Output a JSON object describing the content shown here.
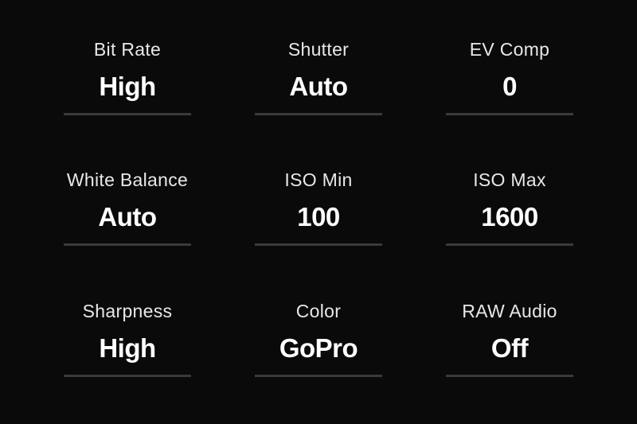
{
  "settings": [
    {
      "label": "Bit Rate",
      "value": "High"
    },
    {
      "label": "Shutter",
      "value": "Auto"
    },
    {
      "label": "EV Comp",
      "value": "0"
    },
    {
      "label": "White Balance",
      "value": "Auto"
    },
    {
      "label": "ISO Min",
      "value": "100"
    },
    {
      "label": "ISO Max",
      "value": "1600"
    },
    {
      "label": "Sharpness",
      "value": "High"
    },
    {
      "label": "Color",
      "value": "GoPro"
    },
    {
      "label": "RAW Audio",
      "value": "Off"
    }
  ]
}
